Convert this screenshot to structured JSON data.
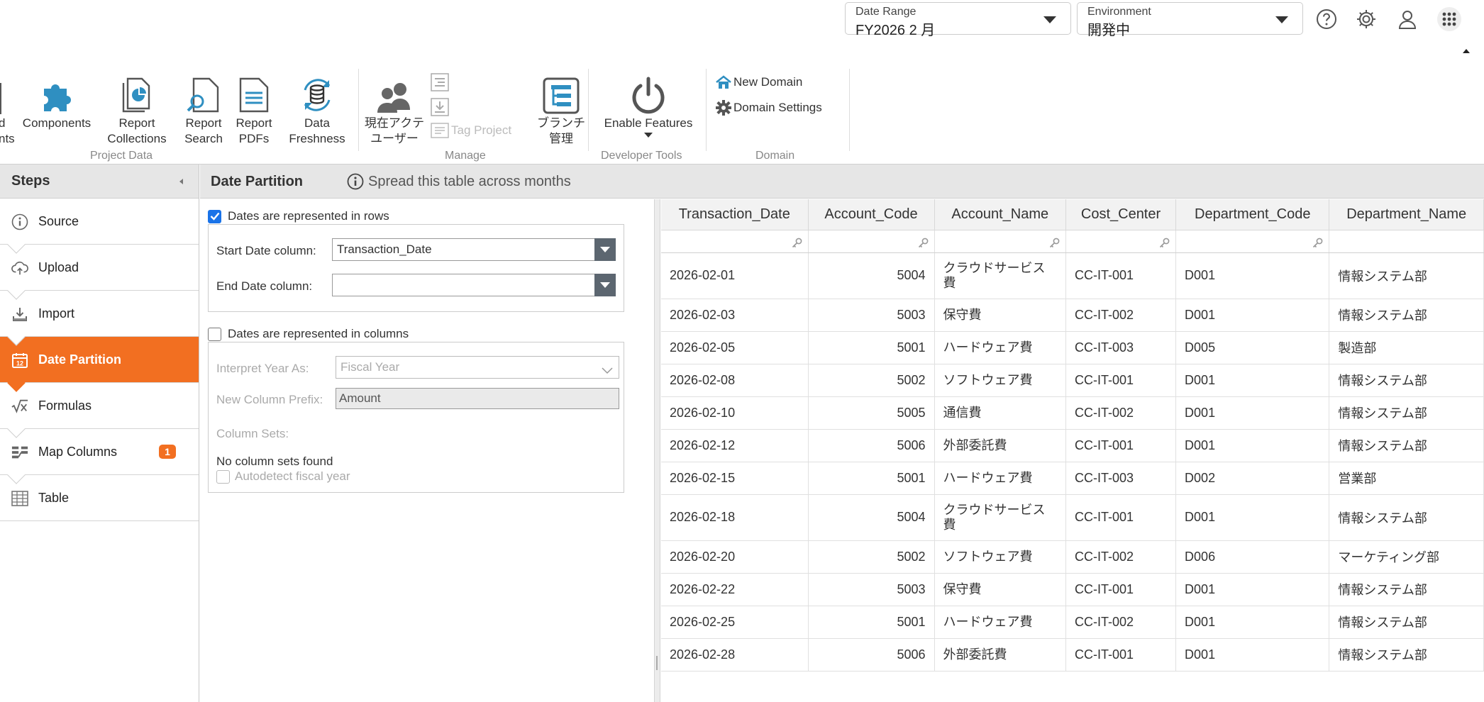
{
  "topbar": {
    "date_range": {
      "label": "Date Range",
      "value": "FY2026 2 月"
    },
    "environment": {
      "label": "Environment",
      "value": "開発中"
    },
    "icons": [
      "help-icon",
      "gear-icon",
      "user-icon",
      "apps-grid-icon"
    ]
  },
  "ribbon": {
    "project_data": {
      "label": "Project Data",
      "items": [
        {
          "label": "d\nnts"
        },
        {
          "label": "Components"
        },
        {
          "label": "Report\nCollections"
        },
        {
          "label": "Report\nSearch"
        },
        {
          "label": "Report\nPDFs"
        },
        {
          "label": "Data\nFreshness"
        }
      ]
    },
    "manage": {
      "label": "Manage",
      "current_users": "現在アクテ\nユーザー",
      "tag_project": "Tag Project",
      "branch_manage": "ブランチ\n管理"
    },
    "developer_tools": {
      "label": "Developer Tools",
      "enable_features": "Enable Features"
    },
    "domain": {
      "label": "Domain",
      "new_domain": "New Domain",
      "domain_settings": "Domain Settings"
    }
  },
  "steps": {
    "title": "Steps",
    "items": [
      {
        "label": "Source",
        "icon": "info-icon"
      },
      {
        "label": "Upload",
        "icon": "cloud-upload-icon"
      },
      {
        "label": "Import",
        "icon": "import-icon"
      },
      {
        "label": "Date Partition",
        "icon": "calendar-icon",
        "active": true
      },
      {
        "label": "Formulas",
        "icon": "sqrt-icon"
      },
      {
        "label": "Map Columns",
        "icon": "map-columns-icon",
        "badge": "1"
      },
      {
        "label": "Table",
        "icon": "table-icon"
      }
    ]
  },
  "content": {
    "title": "Date Partition",
    "hint": "Spread this table across months"
  },
  "form": {
    "rows_checkbox": "Dates are represented in rows",
    "start_date_label": "Start Date column:",
    "start_date_value": "Transaction_Date",
    "end_date_label": "End Date column:",
    "end_date_value": "",
    "columns_checkbox": "Dates are represented in columns",
    "interpret_year_label": "Interpret Year As:",
    "interpret_year_value": "Fiscal Year",
    "prefix_label": "New Column Prefix:",
    "prefix_value": "Amount",
    "column_sets_label": "Column Sets:",
    "no_sets": "No column sets found",
    "autodetect": "Autodetect fiscal year"
  },
  "table": {
    "columns": [
      "Transaction_Date",
      "Account_Code",
      "Account_Name",
      "Cost_Center",
      "Department_Code",
      "Department_Name"
    ],
    "rows": [
      [
        "2026-02-01",
        "5004",
        "クラウドサービス費",
        "CC-IT-001",
        "D001",
        "情報システム部"
      ],
      [
        "2026-02-03",
        "5003",
        "保守費",
        "CC-IT-002",
        "D001",
        "情報システム部"
      ],
      [
        "2026-02-05",
        "5001",
        "ハードウェア費",
        "CC-IT-003",
        "D005",
        "製造部"
      ],
      [
        "2026-02-08",
        "5002",
        "ソフトウェア費",
        "CC-IT-001",
        "D001",
        "情報システム部"
      ],
      [
        "2026-02-10",
        "5005",
        "通信費",
        "CC-IT-002",
        "D001",
        "情報システム部"
      ],
      [
        "2026-02-12",
        "5006",
        "外部委託費",
        "CC-IT-001",
        "D001",
        "情報システム部"
      ],
      [
        "2026-02-15",
        "5001",
        "ハードウェア費",
        "CC-IT-003",
        "D002",
        "営業部"
      ],
      [
        "2026-02-18",
        "5004",
        "クラウドサービス費",
        "CC-IT-001",
        "D001",
        "情報システム部"
      ],
      [
        "2026-02-20",
        "5002",
        "ソフトウェア費",
        "CC-IT-002",
        "D006",
        "マーケティング部"
      ],
      [
        "2026-02-22",
        "5003",
        "保守費",
        "CC-IT-001",
        "D001",
        "情報システム部"
      ],
      [
        "2026-02-25",
        "5001",
        "ハードウェア費",
        "CC-IT-002",
        "D001",
        "情報システム部"
      ],
      [
        "2026-02-28",
        "5006",
        "外部委託費",
        "CC-IT-001",
        "D001",
        "情報システム部"
      ]
    ]
  },
  "colors": {
    "accent": "#f26f21",
    "checkbox": "#1a73e8",
    "icon_blue": "#2f8fc1"
  }
}
